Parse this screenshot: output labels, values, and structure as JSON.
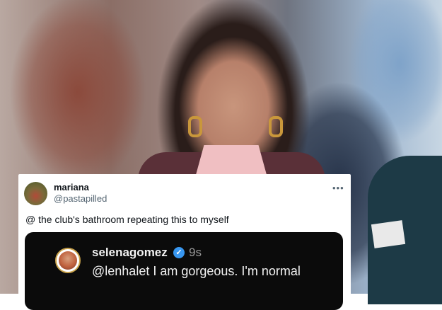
{
  "tweet": {
    "display_name": "mariana",
    "handle": "@pastapilled",
    "more_icon": "more-horizontal-icon",
    "text": "@ the club's bathroom repeating this to myself"
  },
  "embed": {
    "username": "selenagomez",
    "verified_icon": "verified-badge-icon",
    "verified_glyph": "✓",
    "time": "9s",
    "comment": "@lenhalet I am gorgeous. I'm normal"
  },
  "colors": {
    "verified": "#3897f0",
    "embed_bg": "#0b0b0b",
    "card_bg": "#ffffff"
  }
}
